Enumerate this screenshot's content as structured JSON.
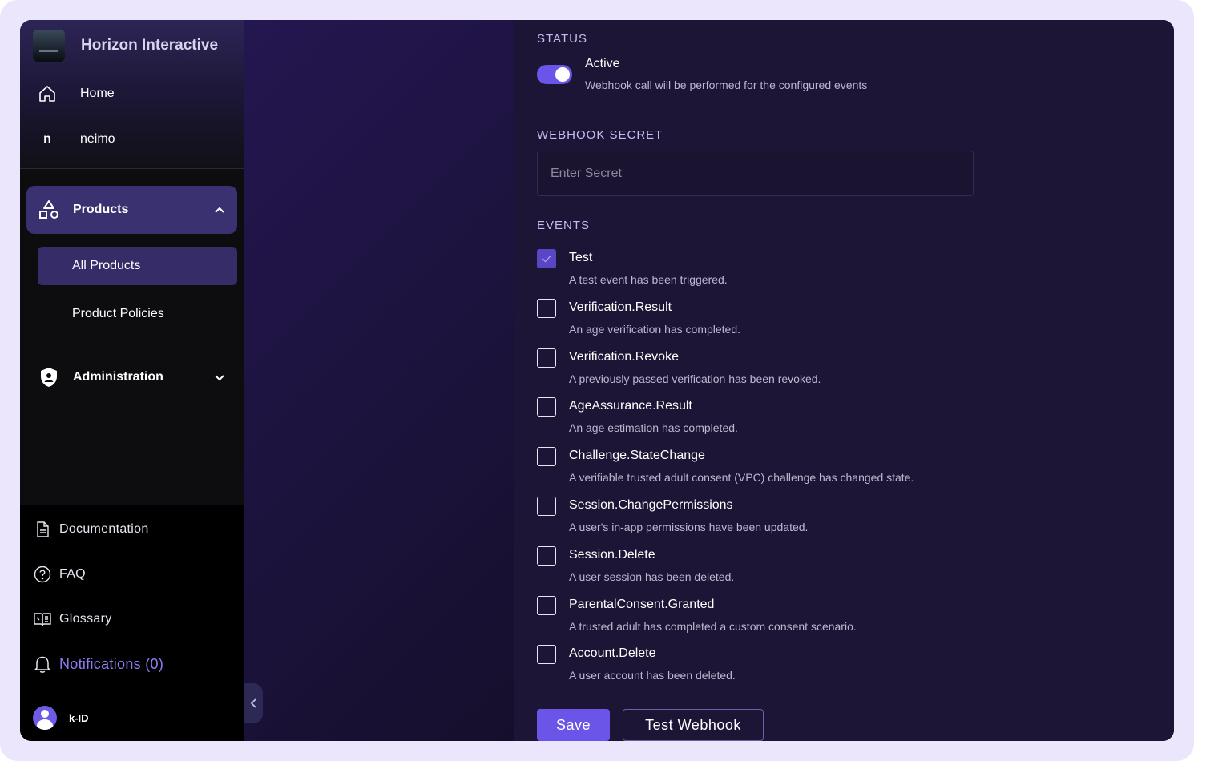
{
  "sidebar": {
    "brand": {
      "name": "Horizon Interactive"
    },
    "nav": {
      "home": "Home",
      "org_initial": "n",
      "org_name": "neimo"
    },
    "products": {
      "label": "Products",
      "items": [
        "All Products",
        "Product Policies"
      ]
    },
    "administration": {
      "label": "Administration"
    },
    "footer": {
      "documentation": "Documentation",
      "faq": "FAQ",
      "glossary": "Glossary",
      "notifications": "Notifications (0)"
    },
    "user": {
      "name": "k-ID"
    }
  },
  "main": {
    "status": {
      "title": "STATUS",
      "label": "Active",
      "description": "Webhook call will be performed for the configured events",
      "enabled": true
    },
    "secret": {
      "title": "WEBHOOK SECRET",
      "placeholder": "Enter Secret",
      "value": ""
    },
    "events": {
      "title": "EVENTS",
      "items": [
        {
          "name": "Test",
          "description": "A test event has been triggered.",
          "checked": true
        },
        {
          "name": "Verification.Result",
          "description": "An age verification has completed.",
          "checked": false
        },
        {
          "name": "Verification.Revoke",
          "description": "A previously passed verification has been revoked.",
          "checked": false
        },
        {
          "name": "AgeAssurance.Result",
          "description": "An age estimation has completed.",
          "checked": false
        },
        {
          "name": "Challenge.StateChange",
          "description": "A verifiable trusted adult consent (VPC) challenge has changed state.",
          "checked": false
        },
        {
          "name": "Session.ChangePermissions",
          "description": "A user's in-app permissions have been updated.",
          "checked": false
        },
        {
          "name": "Session.Delete",
          "description": "A user session has been deleted.",
          "checked": false
        },
        {
          "name": "ParentalConsent.Granted",
          "description": "A trusted adult has completed a custom consent scenario.",
          "checked": false
        },
        {
          "name": "Account.Delete",
          "description": "A user account has been deleted.",
          "checked": false
        }
      ]
    },
    "actions": {
      "save": "Save",
      "test": "Test Webhook"
    }
  },
  "colors": {
    "accent": "#6b55e8",
    "link": "#8f7cf0",
    "sidebar_active": "#3a3170"
  },
  "icons": [
    "home-icon",
    "shapes-icon",
    "chevron-up-icon",
    "shield-icon",
    "chevron-down-icon",
    "document-icon",
    "help-circle-icon",
    "book-icon",
    "bell-icon",
    "chevron-left-icon",
    "check-icon"
  ]
}
